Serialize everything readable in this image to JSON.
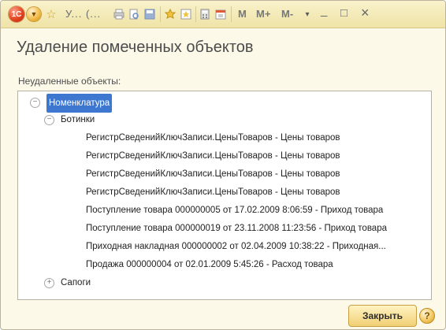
{
  "titlebar": {
    "logo_text": "1C",
    "title": "У... (...",
    "m_label": "M",
    "mplus_label": "M+",
    "mminus_label": "M-",
    "minimize_glyph": "_",
    "maximize_glyph": "□",
    "close_glyph": "×"
  },
  "form": {
    "title": "Удаление помеченных объектов",
    "section_label": "Неудаленные объекты:"
  },
  "tree": {
    "root": "Номенклатура",
    "group1": "Ботинки",
    "items": [
      "РегистрСведенийКлючЗаписи.ЦеныТоваров - Цены товаров",
      "РегистрСведенийКлючЗаписи.ЦеныТоваров - Цены товаров",
      "РегистрСведенийКлючЗаписи.ЦеныТоваров - Цены товаров",
      "РегистрСведенийКлючЗаписи.ЦеныТоваров - Цены товаров",
      "Поступление товара 000000005 от 17.02.2009 8:06:59 - Приход товара",
      "Поступление товара 000000019 от 23.11.2008 11:23:56 - Приход товара",
      "Приходная накладная 000000002 от 02.04.2009 10:38:22 - Приходная...",
      "Продажа 000000004 от 02.01.2009 5:45:26 - Расход товара"
    ],
    "group2": "Сапоги"
  },
  "buttons": {
    "close": "Закрыть",
    "help": "?"
  },
  "colors": {
    "accent": "#3e77cf",
    "background": "#fdf9e8",
    "titlebar": "#f3e8b4"
  }
}
